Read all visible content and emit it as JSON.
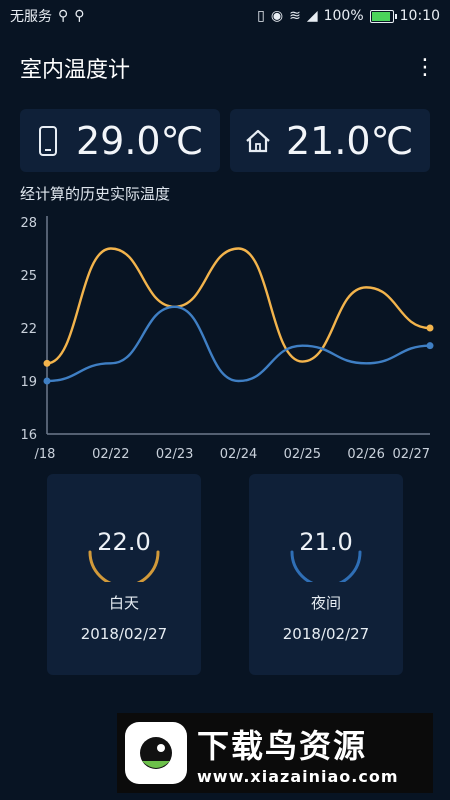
{
  "status_bar": {
    "carrier": "无服务",
    "battery_text": "100%",
    "battery_level": 1.0,
    "time": "10:10"
  },
  "app": {
    "title": "室内温度计"
  },
  "readings": {
    "phone_temp": "29.0℃",
    "room_temp": "21.0℃"
  },
  "chart_section": {
    "title": "经计算的历史实际温度"
  },
  "chart_data": {
    "type": "line",
    "categories": [
      "/18",
      "02/22",
      "02/23",
      "02/24",
      "02/25",
      "02/26",
      "02/27"
    ],
    "x_tick_labels": [
      "/18",
      "02/22",
      "02/23",
      "02/24",
      "02/25",
      "02/26",
      "02/27"
    ],
    "y_ticks": [
      "28",
      "25",
      "22",
      "19",
      "16"
    ],
    "ylim": [
      16,
      28
    ],
    "series": [
      {
        "color": "#f3b44c",
        "values": [
          20.0,
          26.5,
          23.2,
          26.5,
          20.1,
          24.3,
          22.0
        ]
      },
      {
        "color": "#3f7fc4",
        "values": [
          19.0,
          20.0,
          23.2,
          19.0,
          21.0,
          20.0,
          21.0
        ]
      }
    ],
    "grid": false,
    "legend": "none"
  },
  "day_card": {
    "value": "22.0",
    "label": "白天",
    "date": "2018/02/27",
    "gauge_color": "#d29a3a"
  },
  "night_card": {
    "value": "21.0",
    "label": "夜间",
    "date": "2018/02/27",
    "gauge_color": "#2f6fb6"
  },
  "banner": {
    "title": "下载鸟资源",
    "url": "www.xiazainiao.com"
  },
  "colors": {
    "background": "#081423",
    "card": "#0f2038",
    "accent_orange": "#f3b44c",
    "accent_blue": "#3f7fc4"
  }
}
